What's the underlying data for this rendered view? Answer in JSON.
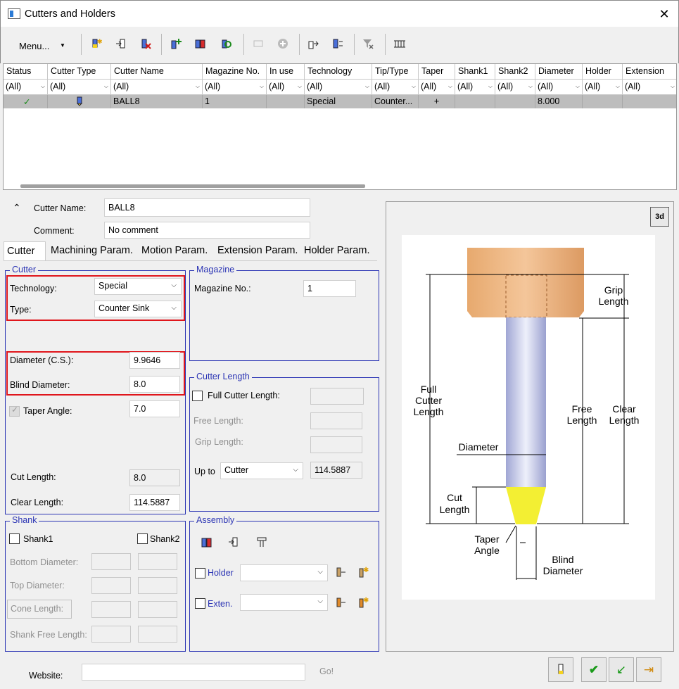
{
  "window": {
    "title": "Cutters and Holders",
    "close_glyph": "✕"
  },
  "toolbar": {
    "menu_label": "Menu...",
    "icons": [
      "new-cutter-icon",
      "import-cutter-icon",
      "delete-cutter-icon",
      "add-icon",
      "copy-icon",
      "edit-icon",
      "disabled-icon",
      "add-circle-icon",
      "export-icon",
      "swap-icon",
      "clear-filter-icon",
      "settings-icon"
    ]
  },
  "grid": {
    "columns": [
      "Status",
      "Cutter Type",
      "Cutter Name",
      "Magazine No.",
      "In use",
      "Technology",
      "Tip/Type",
      "Taper",
      "Shank1",
      "Shank2",
      "Diameter",
      "Holder",
      "Extension"
    ],
    "filter_value": "(All)",
    "row": {
      "status": "✓",
      "type_icon": "cutter-icon",
      "name": "BALL8",
      "magazine": "1",
      "in_use": "",
      "technology": "Special",
      "tip_type": "Counter...",
      "taper": "+",
      "shank1": "",
      "shank2": "",
      "diameter": "8.000",
      "holder": "",
      "extension": ""
    }
  },
  "header": {
    "cutter_name_label": "Cutter Name:",
    "cutter_name": "BALL8",
    "comment_label": "Comment:",
    "comment": "No comment",
    "collapse_glyph": "⌃"
  },
  "tabs": [
    "Cutter",
    "Machining Param.",
    "Motion Param.",
    "Extension Param.",
    "Holder Param."
  ],
  "cutter": {
    "group_title": "Cutter",
    "technology_label": "Technology:",
    "technology": "Special",
    "type_label": "Type:",
    "type": "Counter Sink",
    "diameter_label": "Diameter (C.S.):",
    "diameter": "9.9646",
    "blind_label": "Blind Diameter:",
    "blind": "8.0",
    "taper_label": "Taper Angle:",
    "taper": "7.0",
    "cut_length_label": "Cut Length:",
    "cut_length": "8.0",
    "clear_length_label": "Clear Length:",
    "clear_length": "114.5887"
  },
  "magazine": {
    "group_title": "Magazine",
    "label": "Magazine No.:",
    "value": "1"
  },
  "cutter_length": {
    "group_title": "Cutter Length",
    "full_label": "Full Cutter Length:",
    "free_label": "Free Length:",
    "grip_label": "Grip Length:",
    "upto_label": "Up to",
    "upto_value": "Cutter",
    "upto_result": "114.5887"
  },
  "shank": {
    "group_title": "Shank",
    "shank1_label": "Shank1",
    "shank2_label": "Shank2",
    "bottom_label": "Bottom Diameter:",
    "top_label": "Top Diameter:",
    "cone_label": "Cone Length:",
    "free_label": "Shank Free Length:"
  },
  "assembly": {
    "group_title": "Assembly",
    "holder_label": "Holder",
    "exten_label": "Exten."
  },
  "diagram": {
    "view_3d_label": "3d",
    "labels": {
      "grip": [
        "Grip",
        "Length"
      ],
      "full": [
        "Full",
        "Cutter",
        "Length"
      ],
      "free": [
        "Free",
        "Length"
      ],
      "clear": [
        "Clear",
        "Length"
      ],
      "diameter": "Diameter",
      "cut": [
        "Cut",
        "Length"
      ],
      "taper": [
        "Taper",
        "Angle"
      ],
      "blind": [
        "Blind",
        "Diameter"
      ]
    }
  },
  "footer": {
    "website_label": "Website:",
    "go_label": "Go!"
  }
}
